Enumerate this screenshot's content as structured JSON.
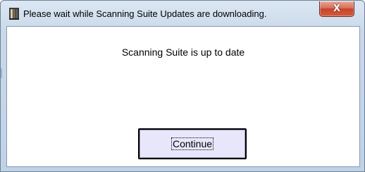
{
  "window": {
    "title": "Please wait while Scanning Suite Updates are downloading.",
    "close_glyph": "X",
    "icon": "app-icon"
  },
  "content": {
    "status_message": "Scanning Suite is up to date",
    "continue_label": "Continue"
  },
  "colors": {
    "button_fill": "#e8e6fa",
    "close_button": "#c4452c",
    "frame": "#c9d9ea"
  }
}
